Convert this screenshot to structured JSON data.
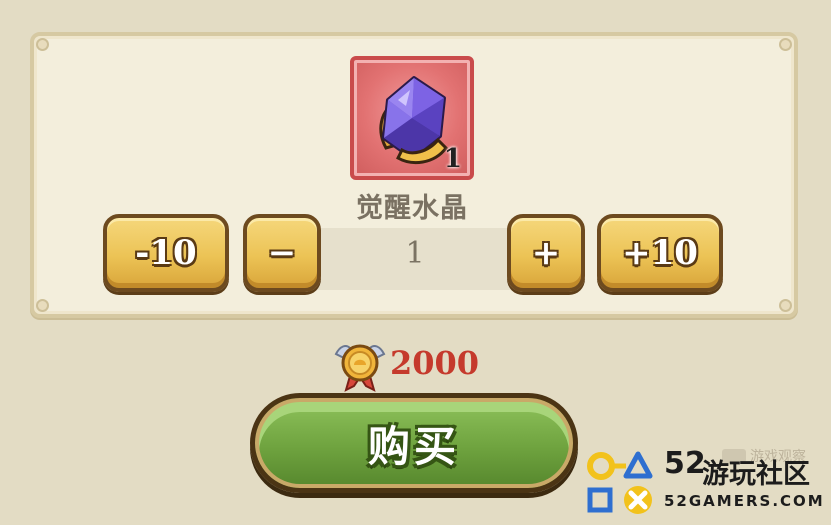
{
  "item": {
    "name": "觉醒水晶",
    "count": "1"
  },
  "quantity": {
    "value": "1"
  },
  "buttons": {
    "minus10": "-10",
    "minus": "−",
    "plus": "+",
    "plus10": "+10"
  },
  "price": {
    "amount": "2000"
  },
  "buy": {
    "label": "购买"
  },
  "watermark": {
    "small_text": "游戏观察",
    "number": "52",
    "name": "游玩社区",
    "site": "52GAMERS.COM"
  },
  "colors": {
    "panel": "#f3eedc",
    "gold_button": "#ecc355",
    "buy_button": "#6fa33f",
    "price_text": "#c53a2c",
    "item_frame": "#e27272"
  },
  "icons": {
    "item": "purple-crystal-icon",
    "currency": "medal-icon"
  }
}
